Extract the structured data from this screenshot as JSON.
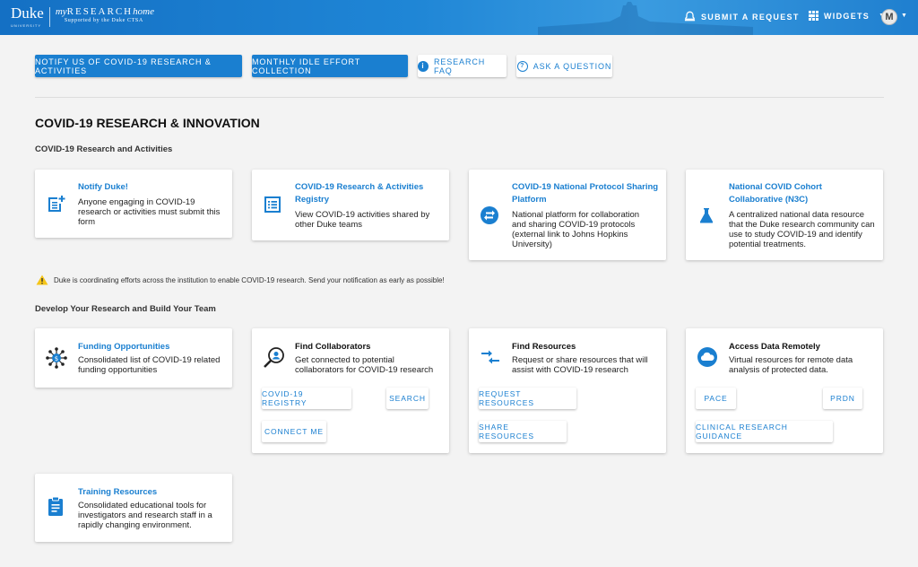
{
  "header": {
    "logo_duke": "Duke",
    "logo_duke_sub": "UNIVERSITY",
    "logo_my": "my",
    "logo_research": "RESEARCH",
    "logo_home": "home",
    "logo_supported": "Supported by the Duke CTSA",
    "submit_request": "SUBMIT A REQUEST",
    "widgets": "WIDGETS",
    "avatar_letter": "M"
  },
  "actions": {
    "notify": "NOTIFY US OF COVID-19 RESEARCH & ACTIVITIES",
    "idle_effort": "MONTHLY IDLE EFFORT COLLECTION",
    "faq": "RESEARCH FAQ",
    "ask": "ASK A QUESTION"
  },
  "page_title": "COVID-19 RESEARCH & INNOVATION",
  "section1": {
    "heading": "COVID-19 Research and Activities",
    "cards": [
      {
        "title": "Notify Duke!",
        "desc": "Anyone engaging in COVID-19 research or activities must submit this form",
        "icon": "form-add-icon"
      },
      {
        "title": "COVID-19 Research & Activities Registry",
        "desc": "View COVID-19 activities shared by other Duke teams",
        "icon": "list-icon"
      },
      {
        "title": "COVID-19 National Protocol Sharing Platform",
        "desc": "National platform for collaboration and sharing COVID-19 protocols (external link to Johns Hopkins University)",
        "icon": "swap-icon"
      },
      {
        "title": "National COVID Cohort Collaborative (N3C)",
        "desc": "A centralized national data resource that the Duke research community can use to study COVID-19 and identify potential treatments.",
        "icon": "flask-icon"
      }
    ]
  },
  "notice": "Duke is coordinating efforts across the institution to enable COVID-19 research. Send your notification as early as possible!",
  "section2": {
    "heading": "Develop Your Research and Build Your Team",
    "funding": {
      "title": "Funding Opportunities",
      "desc": "Consolidated list of COVID-19 related funding opportunities"
    },
    "collab": {
      "title": "Find Collaborators",
      "desc": "Get connected to potential collaborators for COVID-19 research",
      "buttons": [
        "COVID-19 REGISTRY",
        "SEARCH",
        "CONNECT ME"
      ]
    },
    "resources": {
      "title": "Find Resources",
      "desc": "Request or share resources that will assist with COVID-19 research",
      "buttons": [
        "REQUEST RESOURCES",
        "SHARE RESOURCES"
      ]
    },
    "remote": {
      "title": "Access Data Remotely",
      "desc": "Virtual resources for remote data analysis of protected data.",
      "buttons": [
        "PACE",
        "PRDN",
        "CLINICAL RESEARCH GUIDANCE"
      ]
    },
    "training": {
      "title": "Training Resources",
      "desc": "Consolidated educational tools for investigators and research staff in a rapidly changing environment."
    }
  },
  "colors": {
    "brand_blue": "#1a7fd0",
    "topbar": "#1f86d6",
    "warning": "#f5c518"
  }
}
